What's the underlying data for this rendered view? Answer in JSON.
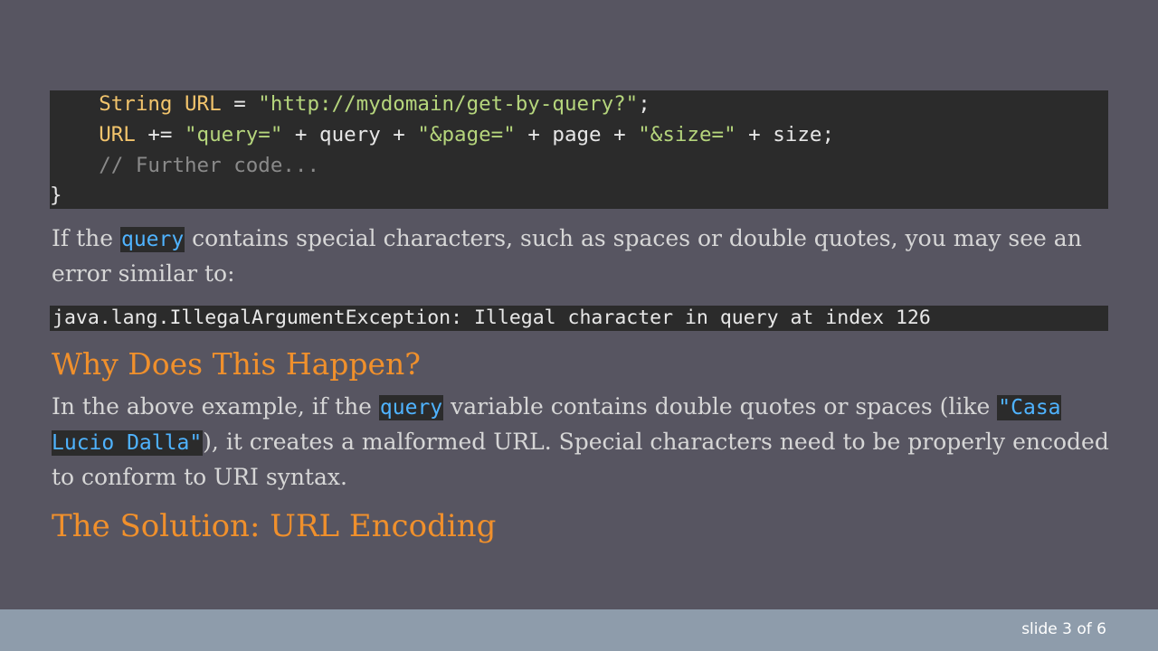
{
  "code": {
    "line1": {
      "indent": "    ",
      "type": "String",
      "var": "URL",
      "eq": " = ",
      "value": "\"http://mydomain/get-by-query?\"",
      "end": ";"
    },
    "line2": {
      "indent": "    ",
      "var": "URL",
      "op": " += ",
      "s1": "\"query=\"",
      "p1": " + query + ",
      "s2": "\"&page=\"",
      "p2": " + page + ",
      "s3": "\"&size=\"",
      "p3": " + size;"
    },
    "line3": {
      "indent": "    ",
      "comment": "// Further code..."
    },
    "line4": {
      "brace": "}"
    }
  },
  "para1": {
    "before": "If the ",
    "code": "query",
    "after": " contains special characters, such as spaces or double quotes, you may see an error similar to:"
  },
  "error_text": "java.lang.IllegalArgumentException: Illegal character in query at index 126",
  "heading1": "Why Does This Happen?",
  "para2": {
    "before": "In the above example, if the ",
    "code1": "query",
    "middle": " variable contains double quotes or spaces (like ",
    "code2": "\"Casa Lucio Dalla\"",
    "after": "), it creates a malformed URL. Special characters need to be properly encoded to conform to URI syntax."
  },
  "heading2": "The Solution: URL Encoding",
  "footer": {
    "slide_counter": "slide 3 of 6"
  },
  "colors": {
    "background": "#575561",
    "code_bg": "#2b2b2b",
    "heading": "#f0902c",
    "inline_code": "#4fb3ff",
    "footer_bg": "#8e9cab"
  }
}
